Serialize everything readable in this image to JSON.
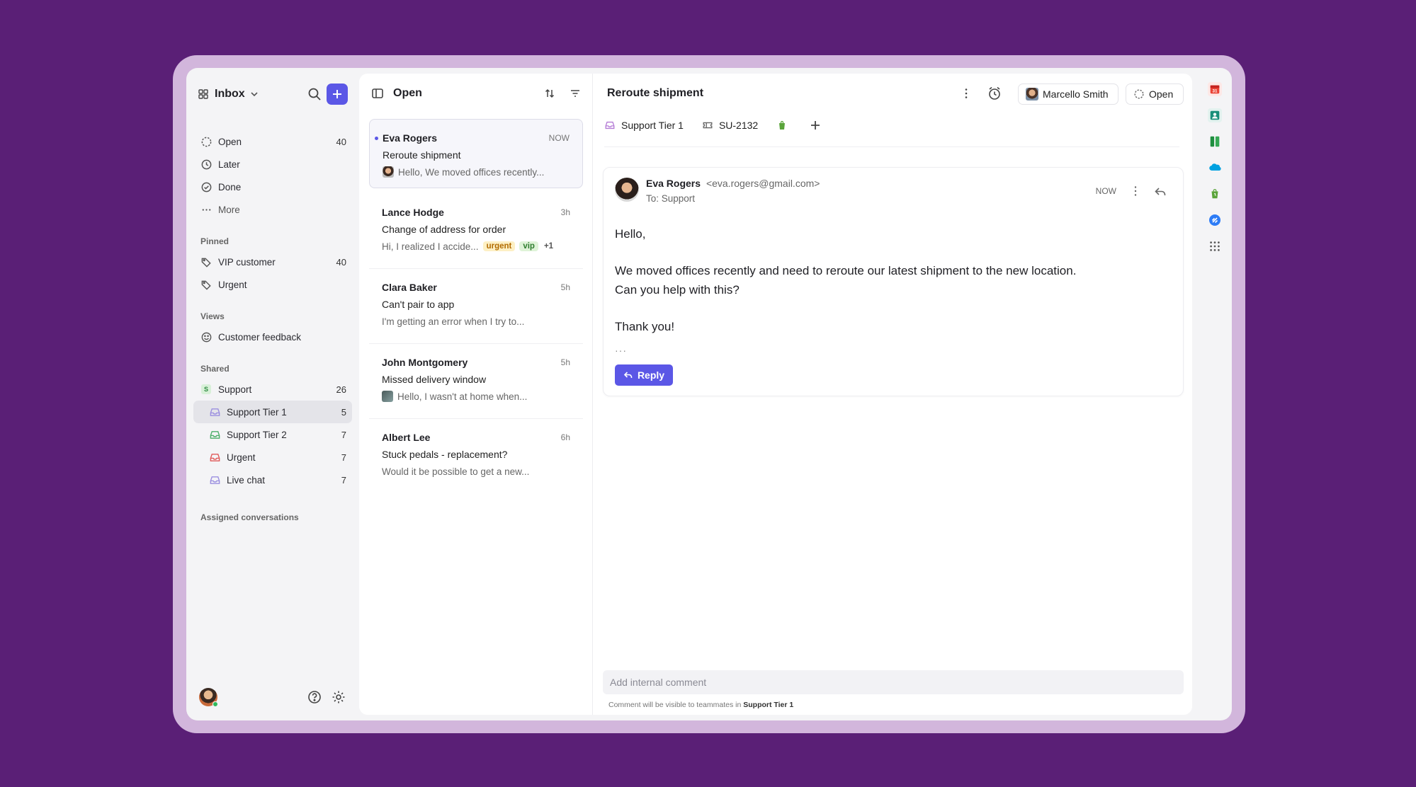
{
  "sidebar": {
    "title": "Inbox",
    "primary": [
      {
        "label": "Open",
        "count": "40",
        "icon": "open-circle-icon"
      },
      {
        "label": "Later",
        "count": "",
        "icon": "clock-icon"
      },
      {
        "label": "Done",
        "count": "",
        "icon": "check-circle-icon"
      },
      {
        "label": "More",
        "count": "",
        "icon": "ellipsis-icon"
      }
    ],
    "pinned_label": "Pinned",
    "pinned": [
      {
        "label": "VIP customer",
        "count": "40"
      },
      {
        "label": "Urgent",
        "count": ""
      }
    ],
    "views_label": "Views",
    "views": [
      {
        "label": "Customer feedback"
      }
    ],
    "shared_label": "Shared",
    "shared_root": {
      "badge": "S",
      "label": "Support",
      "count": "26"
    },
    "shared": [
      {
        "label": "Support Tier 1",
        "count": "5",
        "color": "#9b8fe0"
      },
      {
        "label": "Support Tier 2",
        "count": "7",
        "color": "#4caf6a"
      },
      {
        "label": "Urgent",
        "count": "7",
        "color": "#e05a5a"
      },
      {
        "label": "Live chat",
        "count": "7",
        "color": "#9b8fe0"
      }
    ],
    "assigned_label": "Assigned conversations"
  },
  "list": {
    "title": "Open",
    "conversations": [
      {
        "name": "Eva Rogers",
        "time": "NOW",
        "subject": "Reroute shipment",
        "preview": "Hello, We moved offices recently..."
      },
      {
        "name": "Lance Hodge",
        "time": "3h",
        "subject": "Change of address for order",
        "preview": "Hi, I realized I accide...",
        "tags": [
          "urgent",
          "vip",
          "+1"
        ]
      },
      {
        "name": "Clara Baker",
        "time": "5h",
        "subject": "Can't pair to app",
        "preview": "I'm getting an error when I try to..."
      },
      {
        "name": "John Montgomery",
        "time": "5h",
        "subject": "Missed delivery window",
        "preview": "Hello, I wasn't at home when..."
      },
      {
        "name": "Albert Lee",
        "time": "6h",
        "subject": "Stuck pedals - replacement?",
        "preview": "Would it be possible to get a new..."
      }
    ]
  },
  "main": {
    "title": "Reroute shipment",
    "assignee": "Marcello Smith",
    "status": "Open",
    "inbox": "Support Tier 1",
    "ticket": "SU-2132",
    "message": {
      "from_name": "Eva Rogers",
      "from_email": "<eva.rogers@gmail.com>",
      "to": "To: Support",
      "time": "NOW",
      "greeting": "Hello,",
      "body_line1": "We moved offices recently and need to reroute our latest shipment to the new location.",
      "body_line2": "Can you help with this?",
      "closing": "Thank you!",
      "ellipsis": "···",
      "reply_label": "Reply"
    },
    "comment_placeholder": "Add internal comment",
    "comment_note": "Comment will be visible to teammates in",
    "comment_note_target": "Support Tier 1"
  },
  "colors": {
    "accent": "#5b57e6",
    "background": "#5a1f76"
  }
}
